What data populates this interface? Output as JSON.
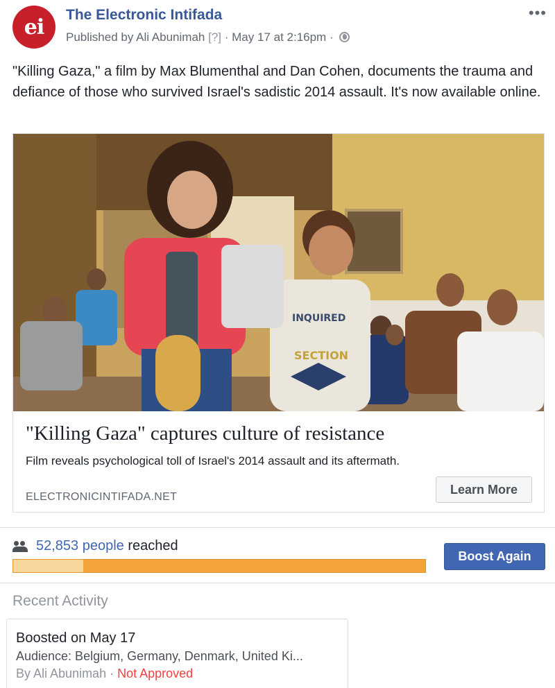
{
  "header": {
    "avatar_text": "ei",
    "page_name": "The Electronic Intifada",
    "published_by": "Published by Ali Abunimah",
    "help": "[?]",
    "separator": "·",
    "date": "May 17 at 2:16pm",
    "more": "•••",
    "privacy_icon": "globe-icon"
  },
  "post": {
    "text": "\"Killing Gaza,\" a film by Max Blumenthal and Dan Cohen, documents the trauma and defiance of those who survived Israel's sadistic 2014 assault. It's now available online."
  },
  "link_card": {
    "image_alt": "photo-children-holding-munitions",
    "shirt_text_1": "INQUIRED",
    "shirt_text_2": "SECTION",
    "title": "\"Killing Gaza\" captures culture of resistance",
    "description": "Film reveals psychological toll of Israel's 2014 assault and its aftermath.",
    "domain": "ELECTRONICINTIFADA.NET",
    "cta": "Learn More"
  },
  "stats": {
    "people_icon": "people-icon",
    "reach_count": "52,853 people",
    "reach_suffix": "reached",
    "boost_label": "Boost Again",
    "progress_fraction": 0.17,
    "colors": {
      "progress_fill": "#f9d69d",
      "progress_bg": "#f2a33a",
      "boost": "#4267b2",
      "link": "#385898"
    }
  },
  "recent": {
    "title": "Recent Activity",
    "item": {
      "title": "Boosted on May 17",
      "audience": "Audience: Belgium, Germany, Denmark, United Ki...",
      "by": "By Ali Abunimah",
      "separator": "·",
      "status": "Not Approved"
    }
  }
}
